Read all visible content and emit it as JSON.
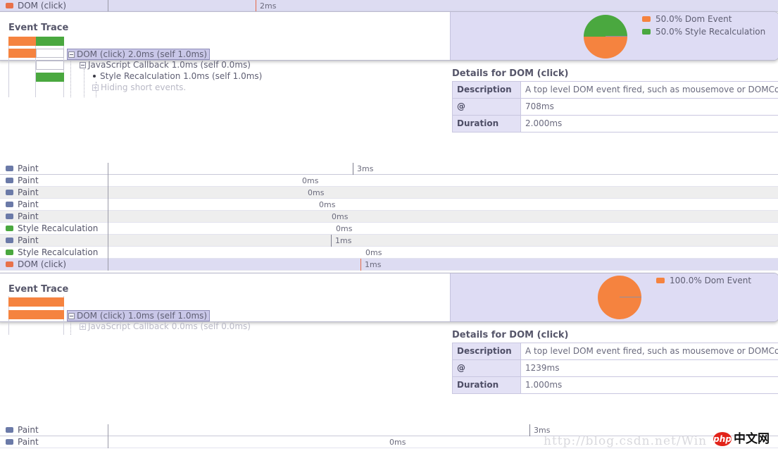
{
  "timeline": {
    "rows_top": [
      {
        "label": "DOM (click)",
        "icon": "dom-swatch",
        "time": "2ms",
        "tick_x": 363,
        "label_x": 366,
        "selected": true,
        "alt": false
      }
    ],
    "rows_mid": [
      {
        "label": "Paint",
        "icon": "paint-swatch",
        "time": "3ms",
        "tick_x": 501,
        "label_x": 504,
        "selected": false,
        "alt": false
      },
      {
        "label": "Paint",
        "icon": "paint-swatch",
        "time": "0ms",
        "tick_x": null,
        "label_x": 426,
        "selected": false,
        "alt": false
      },
      {
        "label": "Paint",
        "icon": "paint-swatch",
        "time": "0ms",
        "tick_x": null,
        "label_x": 434,
        "selected": false,
        "alt": true
      },
      {
        "label": "Paint",
        "icon": "paint-swatch",
        "time": "0ms",
        "tick_x": null,
        "label_x": 450,
        "selected": false,
        "alt": false
      },
      {
        "label": "Paint",
        "icon": "paint-swatch",
        "time": "0ms",
        "tick_x": null,
        "label_x": 468,
        "selected": false,
        "alt": true
      },
      {
        "label": "Style Recalculation",
        "icon": "style-swatch",
        "time": "0ms",
        "tick_x": null,
        "label_x": 474,
        "selected": false,
        "alt": false
      },
      {
        "label": "Paint",
        "icon": "paint-swatch",
        "time": "1ms",
        "tick_x": 470,
        "label_x": 473,
        "selected": false,
        "alt": true
      },
      {
        "label": "Style Recalculation",
        "icon": "style-swatch",
        "time": "0ms",
        "tick_x": null,
        "label_x": 516,
        "selected": false,
        "alt": false
      },
      {
        "label": "DOM (click)",
        "icon": "dom-swatch",
        "time": "1ms",
        "tick_x": 512,
        "label_x": 515,
        "selected": true,
        "alt": false
      }
    ],
    "rows_bottom": [
      {
        "label": "Paint",
        "icon": "paint-swatch",
        "time": "3ms",
        "tick_x": 752,
        "label_x": 755,
        "selected": false,
        "alt": false
      },
      {
        "label": "Paint",
        "icon": "paint-swatch",
        "time": "0ms",
        "tick_x": null,
        "label_x": 550,
        "selected": false,
        "alt": false
      }
    ]
  },
  "panel_one": {
    "trace_title": "Event Trace",
    "pie": {
      "slices": [
        {
          "label": "Style Recalculation",
          "percent": "50.0%",
          "color": "#4aa83f"
        },
        {
          "label": "Dom Event",
          "percent": "50.0%",
          "color": "#f5833f"
        }
      ]
    },
    "legend": [
      {
        "text": "50.0% Dom Event",
        "color": "#f5833f"
      },
      {
        "text": "50.0% Style Recalculation",
        "color": "#4aa83f"
      }
    ],
    "tree": [
      {
        "text": "DOM (click) 2.0ms (self 1.0ms)",
        "state": "selected",
        "marker": "minus",
        "indent": 0
      },
      {
        "text": "JavaScript Callback 1.0ms (self 0.0ms)",
        "state": "normal",
        "marker": "minus",
        "indent": 1
      },
      {
        "text": "Style Recalculation 1.0ms (self 1.0ms)",
        "state": "normal",
        "marker": "bullet",
        "indent": 2
      },
      {
        "text": "Hiding short events.",
        "state": "dim",
        "marker": "plus",
        "indent": 2
      }
    ],
    "details": {
      "title": "Details for DOM (click)",
      "rows": [
        {
          "key": "Description",
          "value": "A top level DOM event fired, such as mousemove or DOMCo"
        },
        {
          "key": "@",
          "value": "708ms"
        },
        {
          "key": "Duration",
          "value": "2.000ms"
        }
      ]
    }
  },
  "panel_two": {
    "trace_title": "Event Trace",
    "pie": {
      "slices": [
        {
          "label": "Dom Event",
          "percent": "100.0%",
          "color": "#f5833f"
        }
      ]
    },
    "legend": [
      {
        "text": "100.0% Dom Event",
        "color": "#f5833f"
      }
    ],
    "tree": [
      {
        "text": "DOM (click) 1.0ms (self 1.0ms)",
        "state": "selected",
        "marker": "minus",
        "indent": 0
      },
      {
        "text": "JavaScript Callback 0.0ms (self 0.0ms)",
        "state": "dim",
        "marker": "plus",
        "indent": 1
      }
    ],
    "details": {
      "title": "Details for DOM (click)",
      "rows": [
        {
          "key": "Description",
          "value": "A top level DOM event fired, such as mousemove or DOMCo"
        },
        {
          "key": "@",
          "value": "1239ms"
        },
        {
          "key": "Duration",
          "value": "1.000ms"
        }
      ]
    }
  },
  "watermark": {
    "url": "http://blog.csdn.net/Win",
    "logo_text": "php",
    "logo_cn": "中文网"
  },
  "colors": {
    "dom_event": "#f5833f",
    "style_recalculation": "#4aa83f",
    "paint": "#6b7aa8",
    "selected_row": "#dddcf2",
    "panel_bg": "#dedcf4"
  }
}
